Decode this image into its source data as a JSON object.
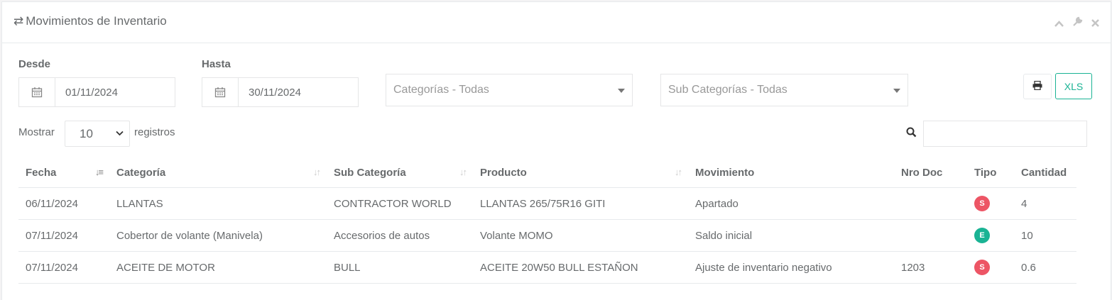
{
  "panel": {
    "title": "Movimientos de Inventario",
    "icons": [
      "swap-icon",
      "chevron-up-icon",
      "wrench-icon",
      "close-icon"
    ]
  },
  "filters": {
    "desde_label": "Desde",
    "desde_value": "01/11/2024",
    "hasta_label": "Hasta",
    "hasta_value": "30/11/2024",
    "categorias_placeholder": "Categorías - Todas",
    "subcategorias_placeholder": "Sub Categorías - Todas",
    "print_icon": "print-icon",
    "xls_label": "XLS"
  },
  "table_controls": {
    "mostrar_label": "Mostrar",
    "length_value": "10",
    "registros_label": "registros",
    "search_value": ""
  },
  "table": {
    "headers": [
      "Fecha",
      "Categoría",
      "Sub Categoría",
      "Producto",
      "Movimiento",
      "Nro Doc",
      "Tipo",
      "Cantidad"
    ],
    "rows": [
      {
        "fecha": "06/11/2024",
        "categoria": "LLANTAS",
        "subcategoria": "CONTRACTOR WORLD",
        "producto": "LLANTAS 265/75R16 GITI",
        "movimiento": "Apartado",
        "nrodoc": "",
        "tipo": "S",
        "tipo_color": "#ed5565",
        "cantidad": "4"
      },
      {
        "fecha": "07/11/2024",
        "categoria": "Cobertor de volante (Manivela)",
        "subcategoria": "Accesorios de autos",
        "producto": "Volante MOMO",
        "movimiento": "Saldo inicial",
        "nrodoc": "",
        "tipo": "E",
        "tipo_color": "#1ab394",
        "cantidad": "10"
      },
      {
        "fecha": "07/11/2024",
        "categoria": "ACEITE DE MOTOR",
        "subcategoria": "BULL",
        "producto": "ACEITE 20W50 BULL ESTAÑON",
        "movimiento": "Ajuste de inventario negativo",
        "nrodoc": "1203",
        "tipo": "S",
        "tipo_color": "#ed5565",
        "cantidad": "0.6"
      }
    ]
  },
  "colors": {
    "accent": "#1ab394",
    "danger": "#ed5565"
  }
}
